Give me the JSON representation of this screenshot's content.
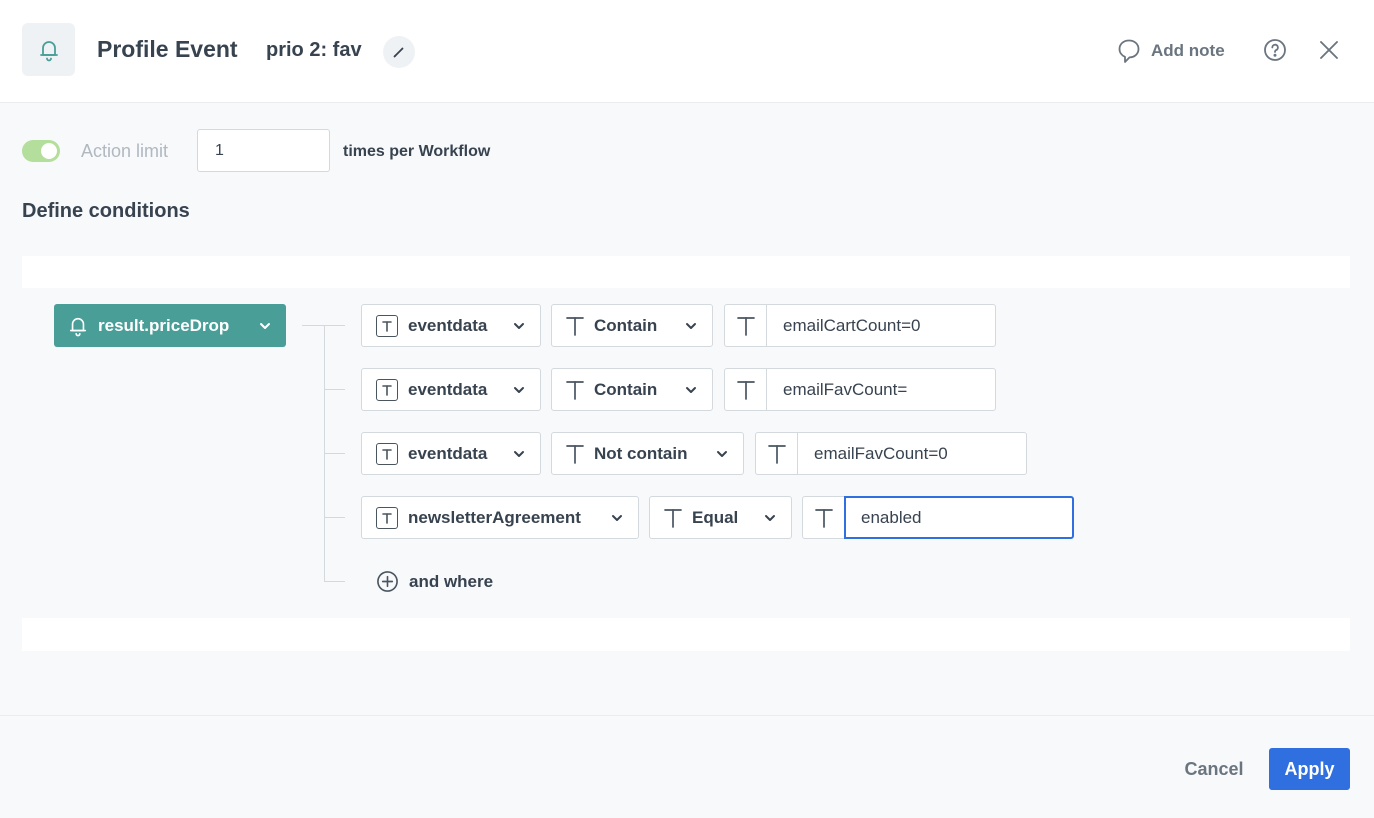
{
  "header": {
    "title": "Profile Event",
    "subtitle": "prio 2: fav",
    "add_note_label": "Add note",
    "icon": "bell-icon"
  },
  "action_limit": {
    "enabled": true,
    "label": "Action limit",
    "value": "1",
    "suffix": "times per Workflow"
  },
  "conditions": {
    "title": "Define conditions",
    "event_name": "result.priceDrop",
    "rows": [
      {
        "parameter": "eventdata",
        "operator": "Contain",
        "value": "emailCartCount=0"
      },
      {
        "parameter": "eventdata",
        "operator": "Contain",
        "value": "emailFavCount="
      },
      {
        "parameter": "eventdata",
        "operator": "Not contain",
        "value": "emailFavCount=0"
      },
      {
        "parameter": "newsletterAgreement",
        "operator": "Equal",
        "value": "enabled"
      }
    ],
    "and_where_label": "and where"
  },
  "footer": {
    "cancel_label": "Cancel",
    "apply_label": "Apply"
  },
  "colors": {
    "accent": "#4a9e98",
    "primary": "#2f6fe0",
    "toggle_on": "#b4de9c"
  }
}
